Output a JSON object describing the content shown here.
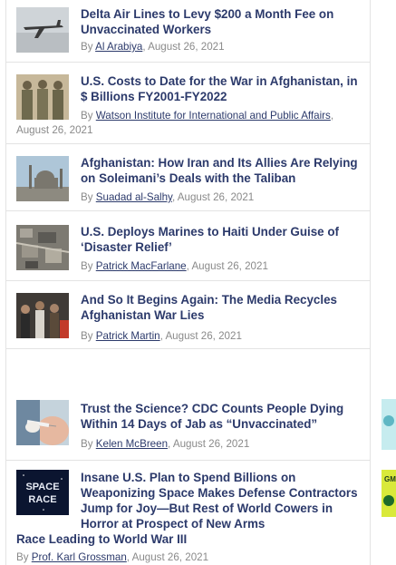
{
  "articles": [
    {
      "title": "Delta Air Lines to Levy $200 a Month Fee on Unvaccinated Workers",
      "by": "By ",
      "author": "Al Arabiya",
      "date": ", August 26, 2021",
      "thumb": "airplane-thumbnail"
    },
    {
      "title": "U.S. Costs to Date for the War in Afghanistan, in $ Billions FY2001-FY2022",
      "by": "By ",
      "author": "Watson Institute for International and Public Affairs",
      "date": ", August 26, 2021",
      "thumb": "soldiers-thumbnail"
    },
    {
      "title": "Afghanistan: How Iran and Its Allies Are Relying on Soleimani’s Deals with the Taliban",
      "by": "By ",
      "author": "Suadad al-Salhy",
      "date": ", August 26, 2021",
      "thumb": "mosque-thumbnail"
    },
    {
      "title": "U.S. Deploys Marines to Haiti Under Guise of ‘Disaster Relief’",
      "by": "By ",
      "author": "Patrick MacFarlane",
      "date": ", August 26, 2021",
      "thumb": "aerial-rubble-thumbnail"
    },
    {
      "title": "And So It Begins Again: The Media Recycles Afghanistan War Lies",
      "by": "By ",
      "author": "Patrick Martin",
      "date": ", August 26, 2021",
      "thumb": "crowd-thumbnail"
    },
    {
      "title": "Trust the Science? CDC Counts People Dying Within 14 Days of Jab as “Unvaccinated”",
      "by": "By ",
      "author": "Kelen McBreen",
      "date": ", August 26, 2021",
      "thumb": "vaccine-thumbnail"
    },
    {
      "title_first": "Insane U.S. Plan to Spend Billions on Weaponizing Space Makes Defense Contractors Jump for Joy—But Rest of World Cowers in Horror at Prospect of New Arms",
      "title_rest": "Race Leading to World War III",
      "by": "By ",
      "author": "Prof. Karl Grossman",
      "date": ", August 26, 2021",
      "thumb_text_1": "SPACE",
      "thumb_text_2": "RACE"
    }
  ],
  "sidebar_ad_text": "GM"
}
